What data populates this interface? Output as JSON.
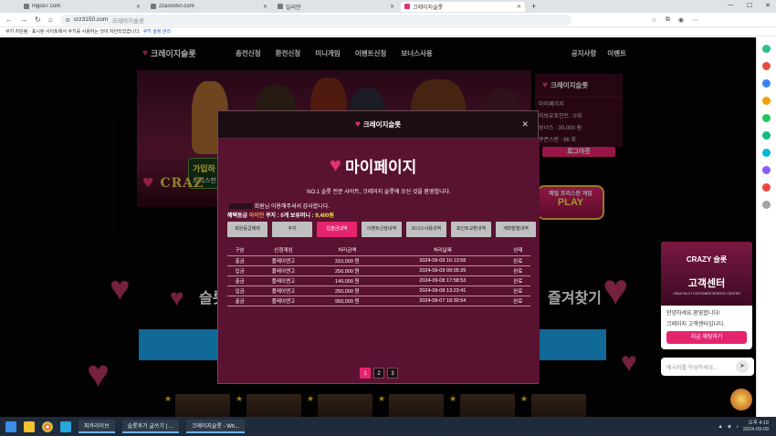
{
  "browser": {
    "tabs": [
      {
        "label": "mgoo7.com",
        "active": false
      },
      {
        "label": "zzas5050.com",
        "active": false
      },
      {
        "label": "일리언",
        "active": false
      },
      {
        "label": "크레이지슬롯",
        "active": true
      }
    ],
    "new_tab": "+",
    "url": "crz3150.com",
    "url_title": "크레이지슬롯",
    "info": "쿠키 차단됨 · 표시된 사이트에서 쿠키를 사용하는 것이 차단되었습니다.",
    "info_link": "쿠키 설정 관리"
  },
  "site": {
    "logo": "크레이지슬롯",
    "menu": [
      "충전신청",
      "환전신청",
      "미니게임",
      "이벤트신청",
      "보너스사용"
    ],
    "menu_right": [
      "공지사항",
      "이벤트"
    ],
    "banner_btn_line1": "가입하",
    "banner_btn_line2": "프리스핀",
    "crazy": "CRAZ",
    "login_box": {
      "title": "크레이지슬롯",
      "rows": [
        "마이페이지",
        "지보유포인트 : 0개",
        "보너스 : 30,000 원",
        "쿠폰스핀 : 66 회"
      ],
      "logout": "로그아웃"
    },
    "play_line1": "매일 프리스핀 게임",
    "play_line2": "PLAY",
    "section_left": "슬롯",
    "section_right": "즐겨찾기",
    "bluebar": "를 하 기"
  },
  "modal": {
    "header_title": "크레이지슬롯",
    "title": "마이페이지",
    "subtitle": "NO.1 슬롯 전문 사이트, 크레이지 슬롯에 오신 것을 환영합니다.",
    "welcome": "회원님 이용해주셔서 감사합니다.",
    "grade_label": "혜택등급",
    "grade_value": "아이언",
    "coupon_label": "쿠지 : 0개",
    "point_label": "보유머니 :",
    "point_value": "9,400원",
    "buttons": [
      "회원등급혜택",
      "쿠지",
      "입출금내역",
      "이벤트신청내역",
      "보너스사용내역",
      "포인트교환내역",
      "계좌발행내역"
    ],
    "active_button": 2,
    "columns": [
      "구분",
      "신청게임",
      "처리금액",
      "처리날짜",
      "상태"
    ],
    "rows": [
      [
        "출금",
        "플레이엔고",
        "310,000 원",
        "2024-09-09 16:13:58",
        "완료"
      ],
      [
        "입금",
        "플레이엔고",
        "250,000 원",
        "2024-09-09 09:05:39",
        "완료"
      ],
      [
        "출금",
        "플레이엔고",
        "140,000 원",
        "2024-09-08 17:58:53",
        "완료"
      ],
      [
        "입금",
        "플레이엔고",
        "250,000 원",
        "2024-09-08 13:23:41",
        "완료"
      ],
      [
        "출금",
        "플레이엔고",
        "950,000 원",
        "2024-09-07 18:30:54",
        "완료"
      ]
    ],
    "pages": [
      "1",
      "2",
      "3"
    ],
    "current_page": "1"
  },
  "support": {
    "brand": "CRAZY 슬롯",
    "title": "고객센터",
    "sub": "CRAZYSLOT CUSTOMER SERVICE CENTER",
    "msg1": "안녕하세요.환영합니다!",
    "msg2": "크레이지 고객센터입니다.",
    "button": "지금 채팅하기",
    "chat_placeholder": "메시지를 작성하세요..."
  },
  "taskbar": {
    "apps": [
      "피카라이브",
      "슬롯후기 글쓰기 | ...",
      "크레이지슬롯 - Wh..."
    ],
    "time": "오후 4:19",
    "date": "2024-09-09"
  },
  "colors": {
    "accent": "#e6246e",
    "bg": "#5a1231",
    "blue": "#1aa2e8"
  }
}
